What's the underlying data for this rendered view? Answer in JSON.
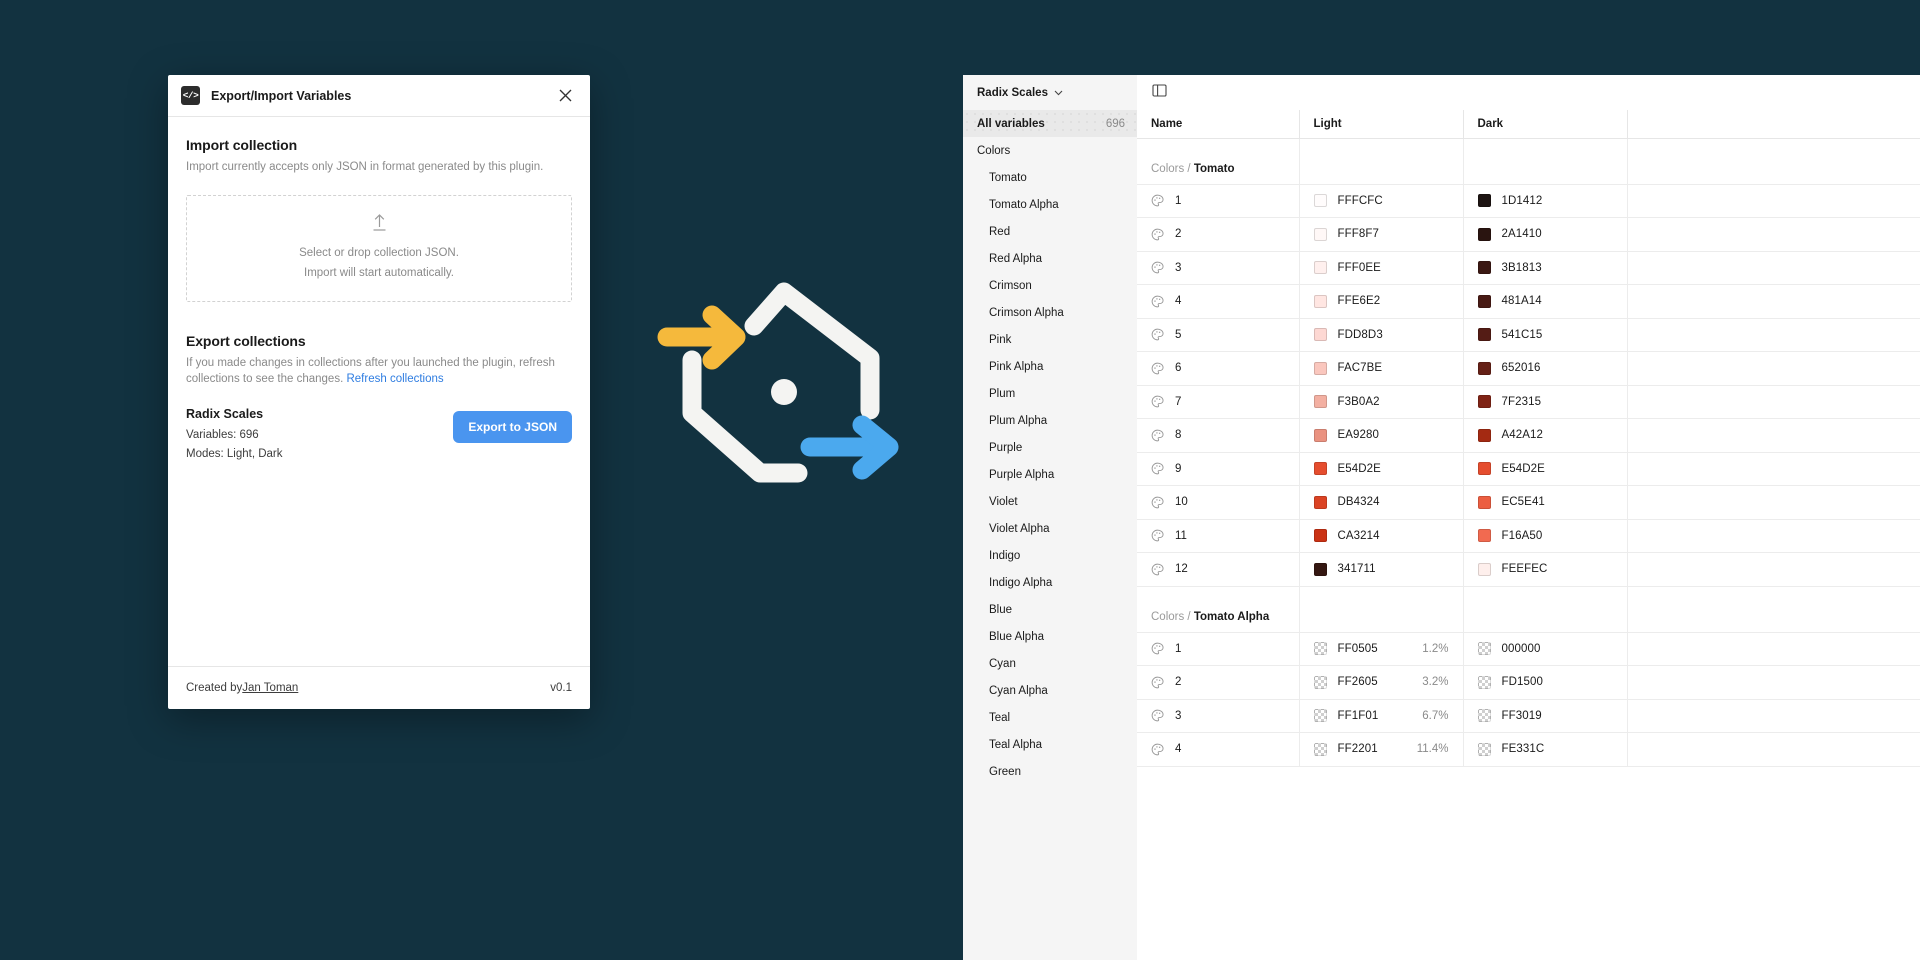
{
  "dialog": {
    "logo_glyph": "</>",
    "title": "Export/Import Variables",
    "close_icon": "close-icon",
    "import": {
      "heading": "Import collection",
      "subtitle": "Import currently accepts only JSON in format generated by this plugin.",
      "dropzone_line1": "Select or drop collection JSON.",
      "dropzone_line2": "Import will start automatically."
    },
    "export": {
      "heading": "Export collections",
      "subtitle_line1": "If you made changes in collections after you launched the plugin, refresh",
      "subtitle_line2": "collections to see the changes.",
      "refresh_link": "Refresh collections",
      "collection_name": "Radix Scales",
      "variables_line": "Variables: 696",
      "modes_line": "Modes: Light, Dark",
      "export_button": "Export to JSON"
    },
    "footer": {
      "created_by_prefix": "Created by ",
      "author": "Jan Toman",
      "version": "v0.1"
    }
  },
  "panel": {
    "collection_select": "Radix Scales",
    "sidebar": {
      "all_variables_label": "All variables",
      "all_variables_count": "696",
      "group_label": "Colors",
      "items": [
        "Tomato",
        "Tomato Alpha",
        "Red",
        "Red Alpha",
        "Crimson",
        "Crimson Alpha",
        "Pink",
        "Pink Alpha",
        "Plum",
        "Plum Alpha",
        "Purple",
        "Purple Alpha",
        "Violet",
        "Violet Alpha",
        "Indigo",
        "Indigo Alpha",
        "Blue",
        "Blue Alpha",
        "Cyan",
        "Cyan Alpha",
        "Teal",
        "Teal Alpha",
        "Green"
      ]
    },
    "table": {
      "columns": [
        "Name",
        "Light",
        "Dark"
      ],
      "groups": [
        {
          "prefix": "Colors / ",
          "name": "Tomato",
          "rows": [
            {
              "name": "1",
              "light": {
                "hex": "FFFCFC",
                "color": "#FFFCFC"
              },
              "dark": {
                "hex": "1D1412",
                "color": "#1D1412"
              }
            },
            {
              "name": "2",
              "light": {
                "hex": "FFF8F7",
                "color": "#FFF8F7"
              },
              "dark": {
                "hex": "2A1410",
                "color": "#2A1410"
              }
            },
            {
              "name": "3",
              "light": {
                "hex": "FFF0EE",
                "color": "#FFF0EE"
              },
              "dark": {
                "hex": "3B1813",
                "color": "#3B1813"
              }
            },
            {
              "name": "4",
              "light": {
                "hex": "FFE6E2",
                "color": "#FFE6E2"
              },
              "dark": {
                "hex": "481A14",
                "color": "#481A14"
              }
            },
            {
              "name": "5",
              "light": {
                "hex": "FDD8D3",
                "color": "#FDD8D3"
              },
              "dark": {
                "hex": "541C15",
                "color": "#541C15"
              }
            },
            {
              "name": "6",
              "light": {
                "hex": "FAC7BE",
                "color": "#FAC7BE"
              },
              "dark": {
                "hex": "652016",
                "color": "#652016"
              }
            },
            {
              "name": "7",
              "light": {
                "hex": "F3B0A2",
                "color": "#F3B0A2"
              },
              "dark": {
                "hex": "7F2315",
                "color": "#7F2315"
              }
            },
            {
              "name": "8",
              "light": {
                "hex": "EA9280",
                "color": "#EA9280"
              },
              "dark": {
                "hex": "A42A12",
                "color": "#A42A12"
              }
            },
            {
              "name": "9",
              "light": {
                "hex": "E54D2E",
                "color": "#E54D2E"
              },
              "dark": {
                "hex": "E54D2E",
                "color": "#E54D2E"
              }
            },
            {
              "name": "10",
              "light": {
                "hex": "DB4324",
                "color": "#DB4324"
              },
              "dark": {
                "hex": "EC5E41",
                "color": "#EC5E41"
              }
            },
            {
              "name": "11",
              "light": {
                "hex": "CA3214",
                "color": "#CA3214"
              },
              "dark": {
                "hex": "F16A50",
                "color": "#F16A50"
              }
            },
            {
              "name": "12",
              "light": {
                "hex": "341711",
                "color": "#341711"
              },
              "dark": {
                "hex": "FEEFEC",
                "color": "#FEEFEC"
              }
            }
          ]
        },
        {
          "prefix": "Colors / ",
          "name": "Tomato Alpha",
          "rows": [
            {
              "name": "1",
              "light": {
                "hex": "FF0505",
                "color": "#FF0505",
                "pct": "1.2%",
                "alpha": true
              },
              "dark": {
                "hex": "000000",
                "color": "#000000",
                "alpha": true
              }
            },
            {
              "name": "2",
              "light": {
                "hex": "FF2605",
                "color": "#FF2605",
                "pct": "3.2%",
                "alpha": true
              },
              "dark": {
                "hex": "FD1500",
                "color": "#FD1500",
                "alpha": true
              }
            },
            {
              "name": "3",
              "light": {
                "hex": "FF1F01",
                "color": "#FF1F01",
                "pct": "6.7%",
                "alpha": true
              },
              "dark": {
                "hex": "FF3019",
                "color": "#FF3019",
                "alpha": true
              }
            },
            {
              "name": "4",
              "light": {
                "hex": "FF2201",
                "color": "#FF2201",
                "pct": "11.4%",
                "alpha": true
              },
              "dark": {
                "hex": "FE331C",
                "color": "#FE331C",
                "alpha": true
              }
            }
          ]
        }
      ]
    }
  }
}
